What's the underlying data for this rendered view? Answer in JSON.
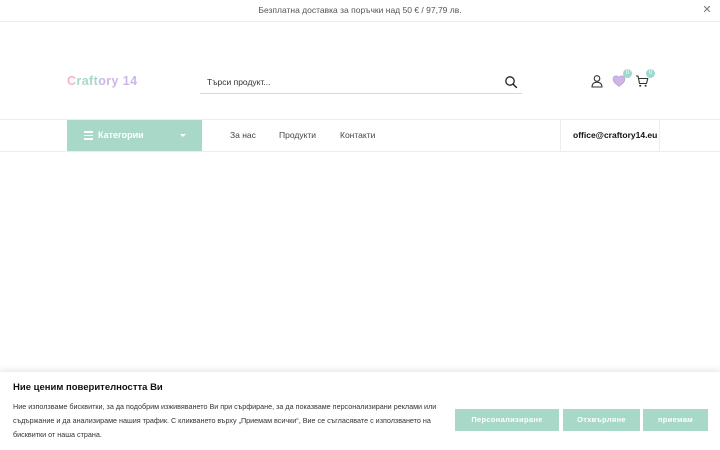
{
  "topbar": {
    "announcement": "Безплатна доставка за поръчки над 50 € / 97,79 лв.",
    "close_icon": "close-icon"
  },
  "header": {
    "logo_text": "Craftory 14",
    "search_placeholder": "Търси продукт...",
    "wishlist_count": "0",
    "cart_count": "0"
  },
  "nav": {
    "categories_label": "Категории",
    "links": [
      "За нас",
      "Продукти",
      "Контакти"
    ],
    "email": "office@craftory14.eu"
  },
  "cookie_banner": {
    "title": "Ние ценим поверителността Ви",
    "text": "Ние използваме бисквитки, за да подобрим изживяването Ви при сърфиране, за да показваме персонализирани реклами или съдържание и да анализираме нашия трафик. С кликването върху „Приемам всички“, Вие се съгласявате с използването на бисквитки от наша страна.",
    "buttons": {
      "customize": "Персонализиране",
      "reject": "Отхвърляне",
      "accept": "приемам"
    }
  },
  "colors": {
    "accent": "#a8d8c8",
    "logo_pink": "#f4b6cb",
    "logo_mint": "#a8d8c8",
    "logo_lilac": "#cdb6e6"
  }
}
